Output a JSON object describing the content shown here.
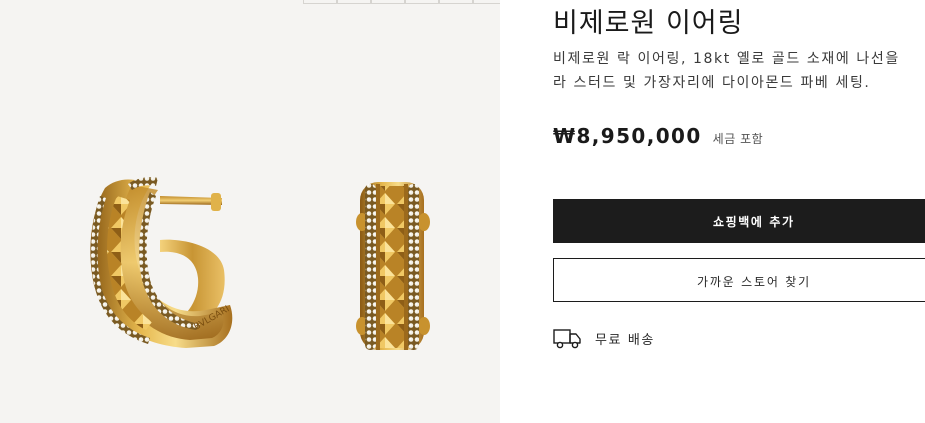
{
  "product": {
    "title": "비제로원 이어링",
    "description_lines": [
      "비제로원 락 이어링, 18kt 옐로 골드 소재에 나선을",
      "라 스터드 및 가장자리에 다이아몬드 파베 세팅."
    ],
    "price": "₩8,950,000",
    "tax_note": "세금 포함"
  },
  "actions": {
    "add_to_bag": "쇼핑백에 추가",
    "find_store": "가까운 스토어 찾기"
  },
  "shipping": {
    "label": "무료 배송",
    "icon": "truck-icon"
  },
  "gallery": {
    "thumbnail_count": 6,
    "image": "gold-hoop-earrings-pair"
  },
  "colors": {
    "gallery_bg": "#f5f4f2",
    "primary_button": "#1c1c1c",
    "gold": "#d4a43a"
  }
}
